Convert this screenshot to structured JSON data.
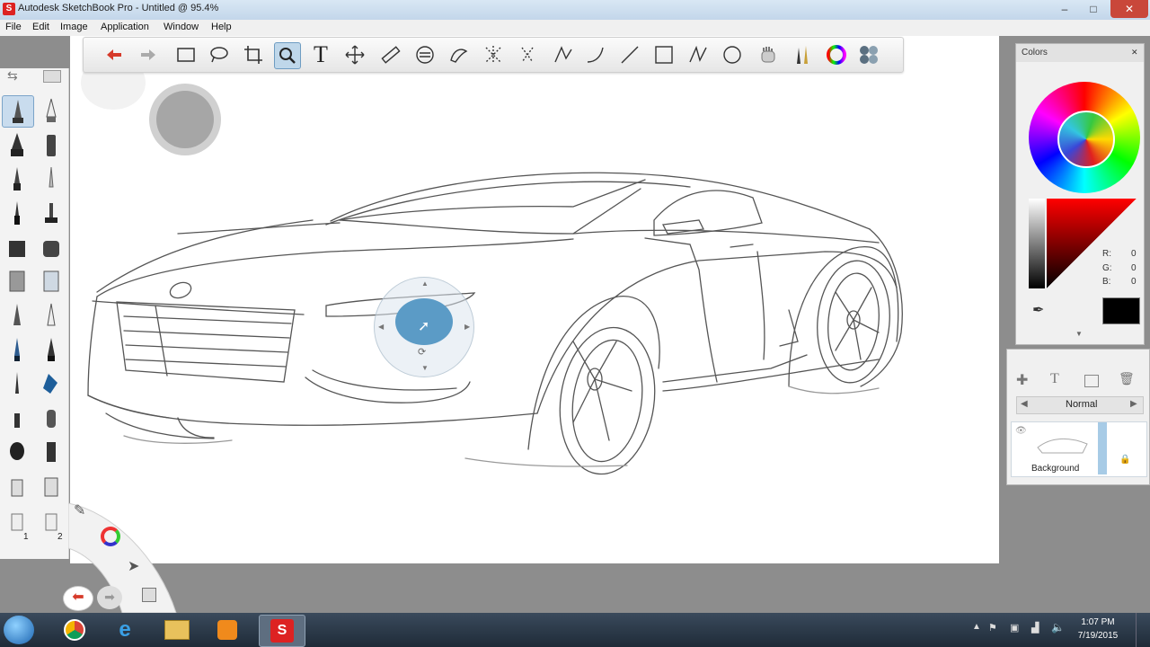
{
  "window": {
    "title": "Autodesk SketchBook Pro - Untitled @ 95.4%",
    "close_label": "✕",
    "minimize_label": "–",
    "maximize_label": "□"
  },
  "menu": [
    "File",
    "Edit",
    "Image",
    "Application",
    "Window",
    "Help"
  ],
  "toolbar": {
    "tools": [
      "undo",
      "redo",
      "select-rect",
      "lasso",
      "crop",
      "zoom",
      "text",
      "move",
      "ruler",
      "ellipse-guide",
      "french-curve",
      "symmetry-x",
      "symmetry-radial",
      "line-stroke",
      "curve",
      "straight-line",
      "rectangle",
      "polyline",
      "oval",
      "hand",
      "brushes",
      "color-wheel",
      "swatches"
    ],
    "active": "zoom",
    "text_tool_label": "T"
  },
  "colors_panel": {
    "title": "Colors",
    "r_label": "R:",
    "r_value": "0",
    "g_label": "G:",
    "g_value": "0",
    "b_label": "B:",
    "b_value": "0",
    "current_color": "#000000"
  },
  "layers_panel": {
    "blend_mode": "Normal",
    "layer_name": "Background"
  },
  "brush_palette": {
    "labels": [
      "1",
      "2"
    ]
  },
  "taskbar": {
    "time": "1:07 PM",
    "date": "7/19/2015"
  }
}
